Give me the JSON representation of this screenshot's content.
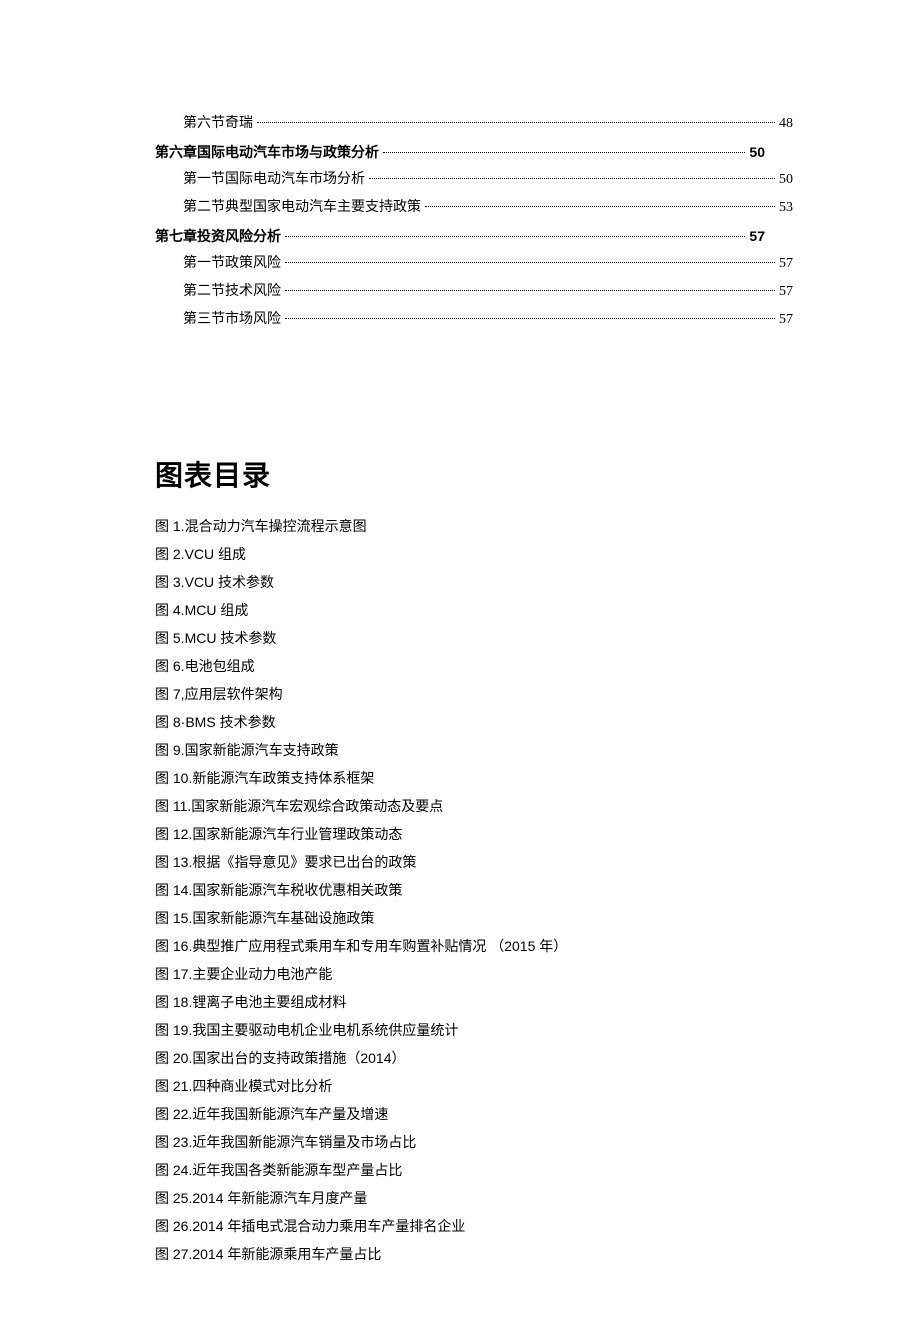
{
  "toc": [
    {
      "level": "indent1",
      "bold": false,
      "label": "第六节奇瑞",
      "page": "48"
    },
    {
      "level": "",
      "bold": true,
      "label": "第六章国际电动汽车市场与政策分析",
      "page": "50"
    },
    {
      "level": "indent1",
      "bold": false,
      "label": "第一节国际电动汽车市场分析",
      "page": "50"
    },
    {
      "level": "indent1",
      "bold": false,
      "label": "第二节典型国家电动汽车主要支持政策",
      "page": "53"
    },
    {
      "level": "",
      "bold": true,
      "label": "第七章投资风险分析",
      "page": "57"
    },
    {
      "level": "indent1",
      "bold": false,
      "label": "第一节政策风险",
      "page": "57"
    },
    {
      "level": "indent1",
      "bold": false,
      "label": "第二节技术风险",
      "page": "57"
    },
    {
      "level": "indent1",
      "bold": false,
      "label": "第三节市场风险",
      "page": "57"
    }
  ],
  "figures_title": "图表目录",
  "figures": [
    "图 1.混合动力汽车操控流程示意图",
    "图 2.VCU 组成",
    "图 3.VCU 技术参数",
    "图 4.MCU 组成",
    "图 5.MCU 技术参数",
    "图 6.电池包组成",
    "图 7,应用层软件架构",
    "图 8·BMS 技术参数",
    "图 9.国家新能源汽车支持政策",
    "图 10.新能源汽车政策支持体系框架",
    "图 11.国家新能源汽车宏观综合政策动态及要点",
    "图 12.国家新能源汽车行业管理政策动态",
    "图 13.根据《指导意见》要求已出台的政策",
    "图 14.国家新能源汽车税收优惠相关政策",
    "图 15.国家新能源汽车基础设施政策",
    "图 16.典型推广应用程式乘用车和专用车购置补贴情况 （2015 年）",
    "图 17.主要企业动力电池产能",
    "图 18.锂离子电池主要组成材料",
    "图 19.我国主要驱动电机企业电机系统供应量统计",
    "图 20.国家出台的支持政策措施（2014）",
    "图 21.四种商业模式对比分析",
    "图 22.近年我国新能源汽车产量及增速",
    "图 23.近年我国新能源汽车销量及市场占比",
    "图 24.近年我国各类新能源车型产量占比",
    "图 25.2014 年新能源汽车月度产量",
    "图 26.2014 年插电式混合动力乘用车产量排名企业",
    "图 27.2014 年新能源乘用车产量占比"
  ]
}
